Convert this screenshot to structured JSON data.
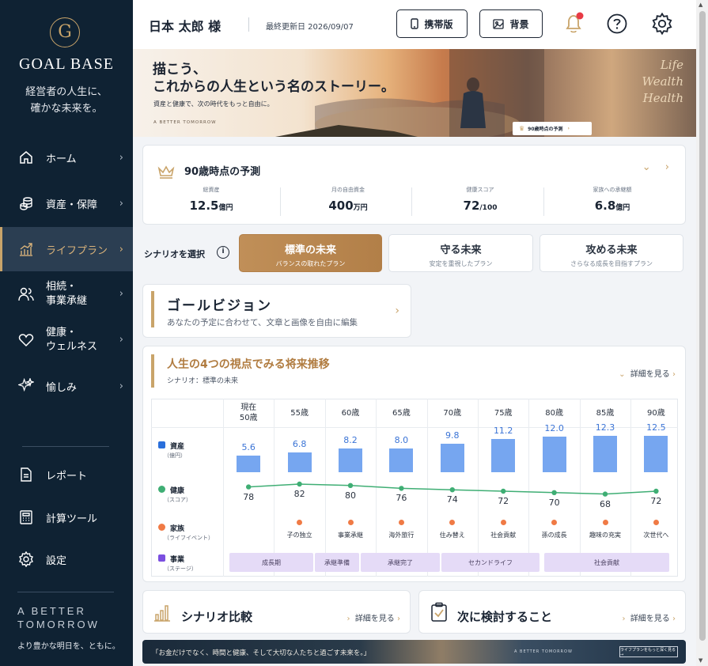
{
  "sidebar": {
    "logo_letter": "G",
    "brand": "GOAL BASE",
    "tagline_1": "経営者の人生に、",
    "tagline_2": "確かな未来を。",
    "items": [
      {
        "label": "ホーム",
        "icon": "home-icon"
      },
      {
        "label": "資産・保障",
        "icon": "coins-icon"
      },
      {
        "label": "ライフプラン",
        "icon": "chart-up-icon",
        "active": true
      },
      {
        "label_1": "相続・",
        "label_2": "事業承継",
        "icon": "people-icon"
      },
      {
        "label_1": "健康・",
        "label_2": "ウェルネス",
        "icon": "heart-icon"
      },
      {
        "label": "愉しみ",
        "icon": "sparkle-icon"
      }
    ],
    "footer_items": [
      {
        "label": "レポート",
        "icon": "report-icon"
      },
      {
        "label": "計算ツール",
        "icon": "calculator-icon"
      },
      {
        "label": "設定",
        "icon": "settings-icon"
      }
    ],
    "bottom_tagline_1": "A BETTER",
    "bottom_tagline_2": "TOMORROW",
    "bottom_tagline_3": "より豊かな明日を、ともに。",
    "chevron": "›"
  },
  "header": {
    "user_name": "日本 太郎 様",
    "updated": "最終更新日 2026/09/07",
    "mobile_btn": "携帯版",
    "background_btn": "背景"
  },
  "hero": {
    "title_1": "描こう、",
    "title_2": "これからの人生という名のストーリー。",
    "subtitle": "資産と健康で、次の時代をもっと自由に。",
    "small": "A BETTER TOMORROW",
    "script_1": "Life",
    "script_2": "Wealth",
    "script_3": "Health",
    "tag": "90歳時点の予測"
  },
  "prediction": {
    "title": "90歳時点の予測",
    "stats": [
      {
        "label": "総資産",
        "value": "12.5",
        "unit": "億円"
      },
      {
        "label": "月の自由資金",
        "value": "400",
        "unit": "万円"
      },
      {
        "label": "健康スコア",
        "value": "72",
        "unit": "/100"
      },
      {
        "label": "家族への承継額",
        "value": "6.8",
        "unit": "億円"
      }
    ]
  },
  "scenario": {
    "label": "シナリオを選択",
    "info": "i",
    "options": [
      {
        "title": "標準の未来",
        "sub": "バランスの取れたプラン",
        "active": true
      },
      {
        "title": "守る未来",
        "sub": "安定を重視したプラン"
      },
      {
        "title": "攻める未来",
        "sub": "さらなる成長を目指すプラン"
      }
    ]
  },
  "goal_vision": {
    "title": "ゴールビジョン",
    "sub": "あなたの予定に合わせて、文章と画像を自由に編集"
  },
  "future": {
    "title": "人生の4つの視点でみる将来推移",
    "sub": "シナリオ：標準の未来",
    "more": "詳細を見る",
    "columns": [
      "現在\n50歳",
      "55歳",
      "60歳",
      "65歳",
      "70歳",
      "75歳",
      "80歳",
      "85歳",
      "90歳"
    ],
    "rows": {
      "assets": {
        "label": "資産",
        "sub": "（億円）",
        "color": "#2a6fdb",
        "values": [
          5.6,
          6.8,
          8.2,
          8.0,
          9.8,
          11.2,
          12.0,
          12.3,
          12.5
        ]
      },
      "health": {
        "label": "健康",
        "sub": "（スコア）",
        "color": "#3fae74",
        "values": [
          78,
          82,
          80,
          76,
          74,
          72,
          70,
          68,
          72
        ]
      },
      "family": {
        "label": "家族",
        "sub": "（ライフイベント）",
        "color": "#f07a45",
        "events": [
          "",
          "子の独立",
          "事業承継",
          "海外旅行",
          "住み替え",
          "社会貢献",
          "孫の成長",
          "趣味の充実",
          "次世代へ"
        ]
      },
      "business": {
        "label": "事業",
        "sub": "（ステージ）",
        "color": "#7b4fe0",
        "stages": [
          "成長期",
          "承継準備",
          "承継完了",
          "セカンドライフ",
          "社会貢献"
        ]
      }
    }
  },
  "bottom": {
    "compare_title": "シナリオ比較",
    "next_title": "次に検討すること",
    "more": "詳細を見る"
  },
  "banner": {
    "text": "「お金だけでなく、時間と健康、そして大切な人たちと過ごす未来を。」",
    "small": "A BETTER TOMORROW",
    "btn": "ライフプランをもっと深く見る →"
  }
}
